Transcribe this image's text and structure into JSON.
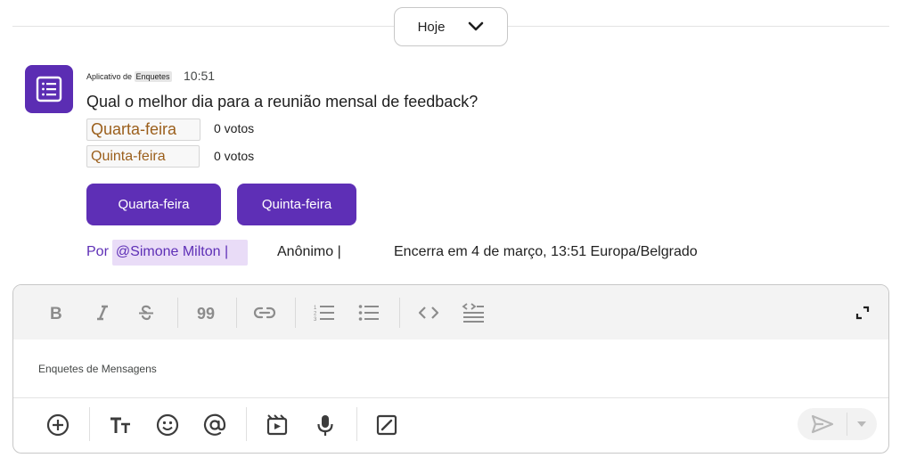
{
  "date_divider": {
    "label": "Hoje",
    "icon": "chevron-down-icon"
  },
  "message": {
    "app_icon": "poll-app-icon",
    "sender_prefix": "Aplicativo de ",
    "sender_highlight": "Enquetes",
    "timestamp": "10:51",
    "question": "Qual o melhor dia para a reunião mensal de feedback?",
    "options": [
      {
        "label": "Quarta-feira",
        "votes": "0 votos"
      },
      {
        "label": "Quinta-feira",
        "votes": "0 votos"
      }
    ],
    "vote_buttons": [
      "Quarta-feira",
      "Quinta-feira"
    ],
    "by_label": "Por",
    "author": "@Simone Milton |",
    "anonymous": "Anônimo |",
    "closes": "Encerra em 4 de março, 13:51 Europa/Belgrado"
  },
  "composer": {
    "placeholder": "Enquetes de Mensagens",
    "format_tools": [
      "bold-icon",
      "italic-icon",
      "strikethrough-icon",
      "quote-icon",
      "link-icon",
      "numbered-list-icon",
      "bulleted-list-icon",
      "code-icon",
      "code-block-icon"
    ],
    "expand_icon": "expand-icon",
    "bottom_tools": [
      "add-icon",
      "text-format-icon",
      "emoji-icon",
      "mention-icon",
      "video-clip-icon",
      "microphone-icon",
      "edit-box-icon"
    ],
    "send_icon": "send-icon",
    "send_dropdown_icon": "caret-down-icon"
  },
  "colors": {
    "accent": "#5e2fb6",
    "option_text": "#9b5f1c",
    "author_highlight": "#e9dcf7"
  }
}
